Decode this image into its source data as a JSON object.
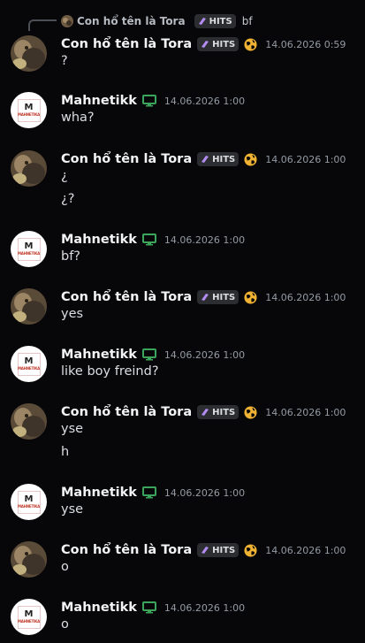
{
  "reply": {
    "author": "Con hổ tên là Tora",
    "badge": "HITS",
    "text": "bf"
  },
  "users": {
    "tora": {
      "name": "Con hổ tên là Tora",
      "badge": "HITS",
      "status_icon": "globe-icon",
      "name_color": "#f2f3f5"
    },
    "mahnetikk": {
      "name": "Mahnetikk",
      "status_icon": "monitor-icon",
      "logo_text": "MAHNETIKA"
    }
  },
  "colors": {
    "background": "#070709",
    "badge_bg": "#2b2d31",
    "badge_icon": "#b28cf0",
    "globe": "#f0b232",
    "monitor": "#3ba55c",
    "timestamp": "#949ba4"
  },
  "messages": [
    {
      "author": "Con hổ tên là Tora",
      "badge": "HITS",
      "timestamp": "14.06.2026 0:59",
      "lines": [
        "?"
      ]
    },
    {
      "author": "Mahnetikk",
      "timestamp": "14.06.2026 1:00",
      "lines": [
        "wha?"
      ]
    },
    {
      "author": "Con hổ tên là Tora",
      "badge": "HITS",
      "timestamp": "14.06.2026 1:00",
      "lines": [
        "¿",
        "¿?"
      ]
    },
    {
      "author": "Mahnetikk",
      "timestamp": "14.06.2026 1:00",
      "lines": [
        "bf?"
      ]
    },
    {
      "author": "Con hổ tên là Tora",
      "badge": "HITS",
      "timestamp": "14.06.2026 1:00",
      "lines": [
        "yes"
      ]
    },
    {
      "author": "Mahnetikk",
      "timestamp": "14.06.2026 1:00",
      "lines": [
        "like boy freind?"
      ]
    },
    {
      "author": "Con hổ tên là Tora",
      "badge": "HITS",
      "timestamp": "14.06.2026 1:00",
      "lines": [
        "yse",
        "h"
      ]
    },
    {
      "author": "Mahnetikk",
      "timestamp": "14.06.2026 1:00",
      "lines": [
        "yse"
      ]
    },
    {
      "author": "Con hổ tên là Tora",
      "badge": "HITS",
      "timestamp": "14.06.2026 1:00",
      "lines": [
        "o"
      ]
    },
    {
      "author": "Mahnetikk",
      "timestamp": "14.06.2026 1:00",
      "lines": [
        "o"
      ]
    }
  ]
}
